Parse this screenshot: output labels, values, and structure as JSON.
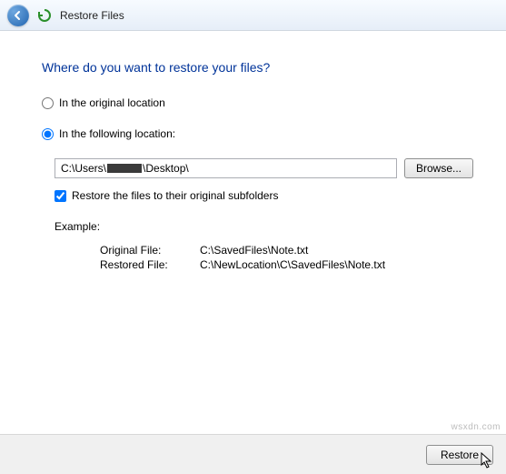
{
  "window": {
    "title": "Restore Files"
  },
  "heading": "Where do you want to restore your files?",
  "options": {
    "original": {
      "label": "In the original location",
      "checked": false
    },
    "following": {
      "label": "In the following location:",
      "checked": true
    }
  },
  "path": {
    "prefix": "C:\\Users\\",
    "suffix": "\\Desktop\\"
  },
  "browse_button": "Browse...",
  "subfolders": {
    "label": "Restore the files to their original subfolders",
    "checked": true
  },
  "example": {
    "heading": "Example:",
    "original_label": "Original File:",
    "original_value": "C:\\SavedFiles\\Note.txt",
    "restored_label": "Restored File:",
    "restored_value": "C:\\NewLocation\\C\\SavedFiles\\Note.txt"
  },
  "restore_button": "Restore",
  "watermark": "wsxdn.com"
}
